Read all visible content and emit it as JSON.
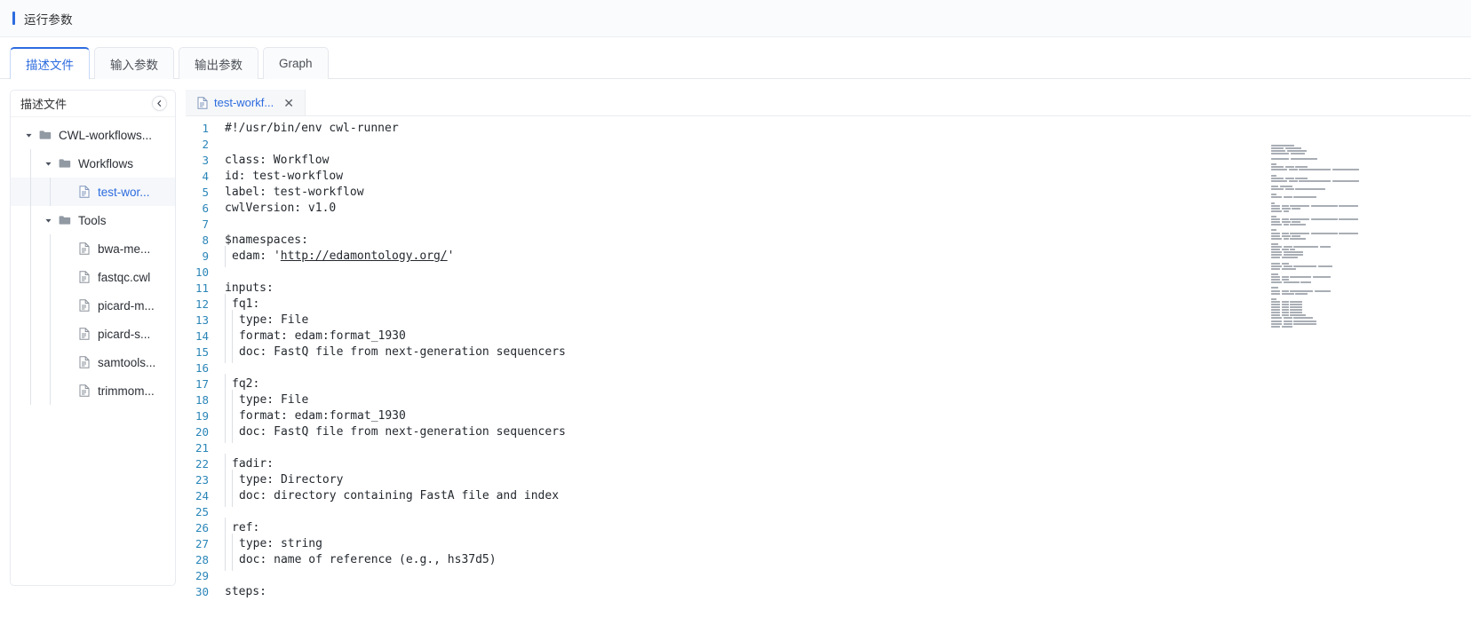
{
  "header": {
    "title": "运行参数",
    "accent_color": "#2d6cdf"
  },
  "tabs": [
    {
      "label": "描述文件",
      "active": true
    },
    {
      "label": "输入参数",
      "active": false
    },
    {
      "label": "输出参数",
      "active": false
    },
    {
      "label": "Graph",
      "active": false
    }
  ],
  "sidebar": {
    "title": "描述文件",
    "collapse_icon": "chevron-left-icon",
    "tree": [
      {
        "label": "CWL-workflows...",
        "type": "folder",
        "depth": 0,
        "expanded": true,
        "selected": false,
        "icon": "folder-icon",
        "caret": "caret-down-icon"
      },
      {
        "label": "Workflows",
        "type": "folder",
        "depth": 1,
        "expanded": true,
        "selected": false,
        "icon": "folder-icon",
        "caret": "caret-down-icon"
      },
      {
        "label": "test-wor...",
        "type": "file",
        "depth": 2,
        "expanded": false,
        "selected": true,
        "icon": "file-icon",
        "caret": ""
      },
      {
        "label": "Tools",
        "type": "folder",
        "depth": 1,
        "expanded": true,
        "selected": false,
        "icon": "folder-icon",
        "caret": "caret-down-icon"
      },
      {
        "label": "bwa-me...",
        "type": "file",
        "depth": 2,
        "expanded": false,
        "selected": false,
        "icon": "file-icon",
        "caret": ""
      },
      {
        "label": "fastqc.cwl",
        "type": "file",
        "depth": 2,
        "expanded": false,
        "selected": false,
        "icon": "file-icon",
        "caret": ""
      },
      {
        "label": "picard-m...",
        "type": "file",
        "depth": 2,
        "expanded": false,
        "selected": false,
        "icon": "file-icon",
        "caret": ""
      },
      {
        "label": "picard-s...",
        "type": "file",
        "depth": 2,
        "expanded": false,
        "selected": false,
        "icon": "file-icon",
        "caret": ""
      },
      {
        "label": "samtools...",
        "type": "file",
        "depth": 2,
        "expanded": false,
        "selected": false,
        "icon": "file-icon",
        "caret": ""
      },
      {
        "label": "trimmom...",
        "type": "file",
        "depth": 2,
        "expanded": false,
        "selected": false,
        "icon": "file-icon",
        "caret": ""
      }
    ]
  },
  "editor": {
    "open_tabs": [
      {
        "label": "test-workf...",
        "icon": "file-icon",
        "close_label": "✕",
        "active": true
      }
    ],
    "first_line_number": 1,
    "lines": [
      {
        "n": 1,
        "indent": 0,
        "text": "#!/usr/bin/env cwl-runner"
      },
      {
        "n": 2,
        "indent": 0,
        "text": ""
      },
      {
        "n": 3,
        "indent": 0,
        "text": "class: Workflow"
      },
      {
        "n": 4,
        "indent": 0,
        "text": "id: test-workflow"
      },
      {
        "n": 5,
        "indent": 0,
        "text": "label: test-workflow"
      },
      {
        "n": 6,
        "indent": 0,
        "text": "cwlVersion: v1.0"
      },
      {
        "n": 7,
        "indent": 0,
        "text": ""
      },
      {
        "n": 8,
        "indent": 0,
        "text": "$namespaces:"
      },
      {
        "n": 9,
        "indent": 1,
        "text": "edam: 'http://edamontology.org/'",
        "link": "http://edamontology.org/"
      },
      {
        "n": 10,
        "indent": 0,
        "text": ""
      },
      {
        "n": 11,
        "indent": 0,
        "text": "inputs:"
      },
      {
        "n": 12,
        "indent": 1,
        "text": "fq1:"
      },
      {
        "n": 13,
        "indent": 2,
        "text": "type: File"
      },
      {
        "n": 14,
        "indent": 2,
        "text": "format: edam:format_1930"
      },
      {
        "n": 15,
        "indent": 2,
        "text": "doc: FastQ file from next-generation sequencers"
      },
      {
        "n": 16,
        "indent": 0,
        "text": ""
      },
      {
        "n": 17,
        "indent": 1,
        "text": "fq2:"
      },
      {
        "n": 18,
        "indent": 2,
        "text": "type: File"
      },
      {
        "n": 19,
        "indent": 2,
        "text": "format: edam:format_1930"
      },
      {
        "n": 20,
        "indent": 2,
        "text": "doc: FastQ file from next-generation sequencers"
      },
      {
        "n": 21,
        "indent": 0,
        "text": ""
      },
      {
        "n": 22,
        "indent": 1,
        "text": "fadir:"
      },
      {
        "n": 23,
        "indent": 2,
        "text": "type: Directory"
      },
      {
        "n": 24,
        "indent": 2,
        "text": "doc: directory containing FastA file and index"
      },
      {
        "n": 25,
        "indent": 0,
        "text": ""
      },
      {
        "n": 26,
        "indent": 1,
        "text": "ref:"
      },
      {
        "n": 27,
        "indent": 2,
        "text": "type: string"
      },
      {
        "n": 28,
        "indent": 2,
        "text": "doc: name of reference (e.g., hs37d5)"
      },
      {
        "n": 29,
        "indent": 0,
        "text": ""
      },
      {
        "n": 30,
        "indent": 0,
        "text": "steps:"
      }
    ],
    "minimap": {
      "present": true,
      "rows": [
        [
          26
        ],
        [
          14,
          18
        ],
        [
          16,
          22
        ],
        [
          20,
          16
        ],
        [
          0
        ],
        [
          20,
          30
        ],
        [
          0
        ],
        [
          6
        ],
        [
          14,
          10,
          14
        ],
        [
          18,
          10,
          36,
          30
        ],
        [
          0
        ],
        [
          6
        ],
        [
          14,
          10,
          14
        ],
        [
          18,
          10,
          36,
          30
        ],
        [
          0
        ],
        [
          8,
          14
        ],
        [
          14,
          10,
          34
        ],
        [
          0
        ],
        [
          6
        ],
        [
          12,
          10,
          26
        ],
        [
          0
        ],
        [
          4
        ],
        [
          10,
          8,
          22,
          30,
          22
        ],
        [
          10,
          10,
          10
        ],
        [
          12,
          6
        ],
        [
          0
        ],
        [
          6
        ],
        [
          10,
          8,
          22,
          30,
          22
        ],
        [
          10,
          10,
          10
        ],
        [
          12,
          6,
          18
        ],
        [
          0
        ],
        [
          6
        ],
        [
          10,
          8,
          22,
          30,
          22
        ],
        [
          10,
          10,
          10
        ],
        [
          12,
          6,
          18
        ],
        [
          0
        ],
        [
          8
        ],
        [
          12,
          10,
          28,
          12
        ],
        [
          10,
          8,
          6
        ],
        [
          12,
          22
        ],
        [
          12,
          22
        ],
        [
          10,
          18
        ],
        [
          0
        ],
        [
          10,
          8
        ],
        [
          12,
          10,
          26,
          16
        ],
        [
          10,
          16
        ],
        [
          0
        ],
        [
          8
        ],
        [
          10,
          8,
          24,
          20
        ],
        [
          10,
          8
        ],
        [
          12,
          18,
          12
        ],
        [
          0
        ],
        [
          8
        ],
        [
          10,
          8,
          26,
          18
        ],
        [
          10,
          14,
          14
        ],
        [
          0
        ],
        [
          6
        ],
        [
          10,
          8,
          14
        ],
        [
          10,
          8,
          14
        ],
        [
          10,
          8,
          14
        ],
        [
          10,
          8,
          14
        ],
        [
          10,
          8,
          14
        ],
        [
          10,
          8,
          18
        ],
        [
          12,
          10,
          22
        ],
        [
          12,
          10,
          26
        ],
        [
          12,
          10,
          26
        ],
        [
          10,
          12
        ]
      ]
    }
  }
}
